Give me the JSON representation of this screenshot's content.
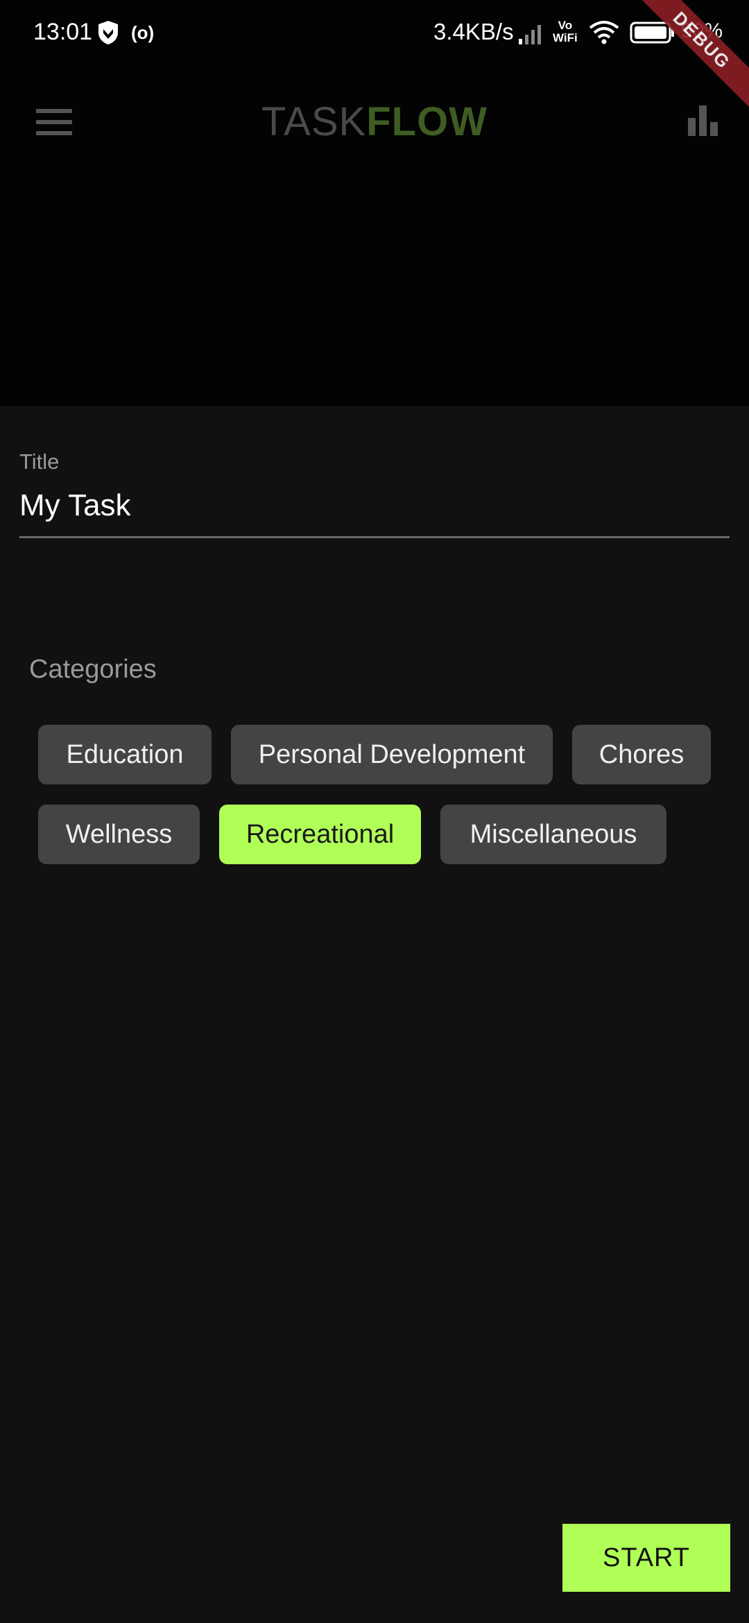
{
  "status_bar": {
    "time": "13:01",
    "radio_icon_text": "(o)",
    "net_speed": "3.4KB/s",
    "vowifi_top": "Vo",
    "vowifi_bottom": "WiFi",
    "battery_text": "90%",
    "icons": [
      "shield-icon",
      "radio-icon",
      "signal-icon",
      "wifi-icon",
      "battery-icon"
    ]
  },
  "debug_banner": "DEBUG",
  "app_bar": {
    "title_part1": "TASK",
    "title_part2": "FLOW",
    "title_part2_color": "#3f5c22",
    "left_icon": "menu-icon",
    "right_icon": "bar-chart-icon"
  },
  "form": {
    "title_label": "Title",
    "title_value": "My Task",
    "categories_label": "Categories",
    "categories": [
      {
        "label": "Education",
        "selected": false
      },
      {
        "label": "Personal Development",
        "selected": false
      },
      {
        "label": "Chores",
        "selected": false
      },
      {
        "label": "Wellness",
        "selected": false
      },
      {
        "label": "Recreational",
        "selected": true
      },
      {
        "label": "Miscellaneous",
        "selected": false
      }
    ],
    "accent_color": "#b0ff57"
  },
  "start_button": {
    "label": "START"
  }
}
